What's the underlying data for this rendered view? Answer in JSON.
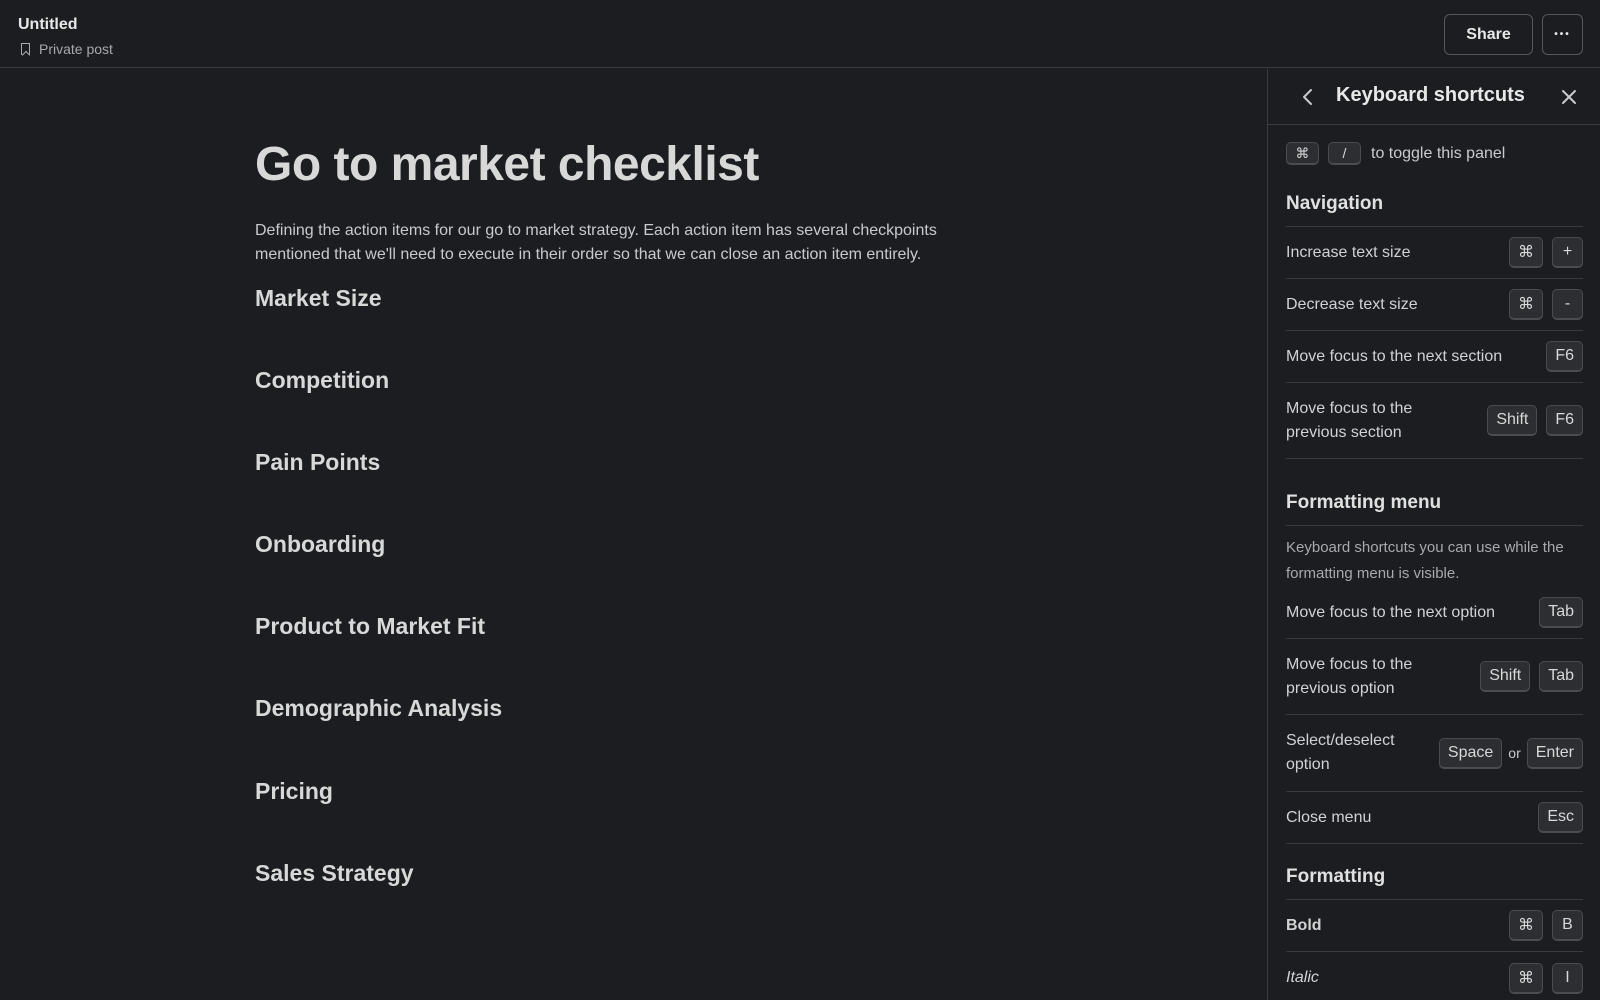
{
  "header": {
    "title": "Untitled",
    "subtitle": "Private post",
    "share_label": "Share",
    "more_label": "•••"
  },
  "document": {
    "title": "Go to market checklist",
    "intro": "Defining  the action items for our go to market strategy. Each action item has several checkpoints mentioned that we'll need to execute in their order so that we can close an action item entirely.",
    "sections": [
      "Market Size",
      "Competition",
      "Pain Points",
      "Onboarding",
      "Product to Market Fit",
      "Demographic Analysis",
      "Pricing",
      "Sales Strategy"
    ]
  },
  "panel": {
    "title": "Keyboard shortcuts",
    "toggle": {
      "keys": [
        "⌘",
        "/"
      ],
      "text": "to toggle this panel"
    },
    "navigation": {
      "title": "Navigation",
      "rows": [
        {
          "label": "Increase text size",
          "keys": [
            "⌘",
            "+"
          ]
        },
        {
          "label": "Decrease text size",
          "keys": [
            "⌘",
            "-"
          ]
        },
        {
          "label": "Move focus to the next section",
          "keys": [
            "F6"
          ]
        },
        {
          "label": "Move focus to the previous section",
          "keys": [
            "Shift",
            "F6"
          ]
        }
      ]
    },
    "formatting_menu": {
      "title": "Formatting menu",
      "description": "Keyboard shortcuts you can use while the formatting menu is visible.",
      "rows": [
        {
          "label": "Move focus to the next option",
          "keys": [
            "Tab"
          ]
        },
        {
          "label": "Move focus to the previous option",
          "keys": [
            "Shift",
            "Tab"
          ]
        },
        {
          "label": "Select/deselect option",
          "keys": [
            "Space",
            "Enter"
          ],
          "separator": "or"
        },
        {
          "label": "Close menu",
          "keys": [
            "Esc"
          ]
        }
      ]
    },
    "formatting": {
      "title": "Formatting",
      "rows": [
        {
          "label": "Bold",
          "keys": [
            "⌘",
            "B"
          ]
        },
        {
          "label": "Italic",
          "keys": [
            "⌘",
            "I"
          ]
        }
      ]
    }
  }
}
